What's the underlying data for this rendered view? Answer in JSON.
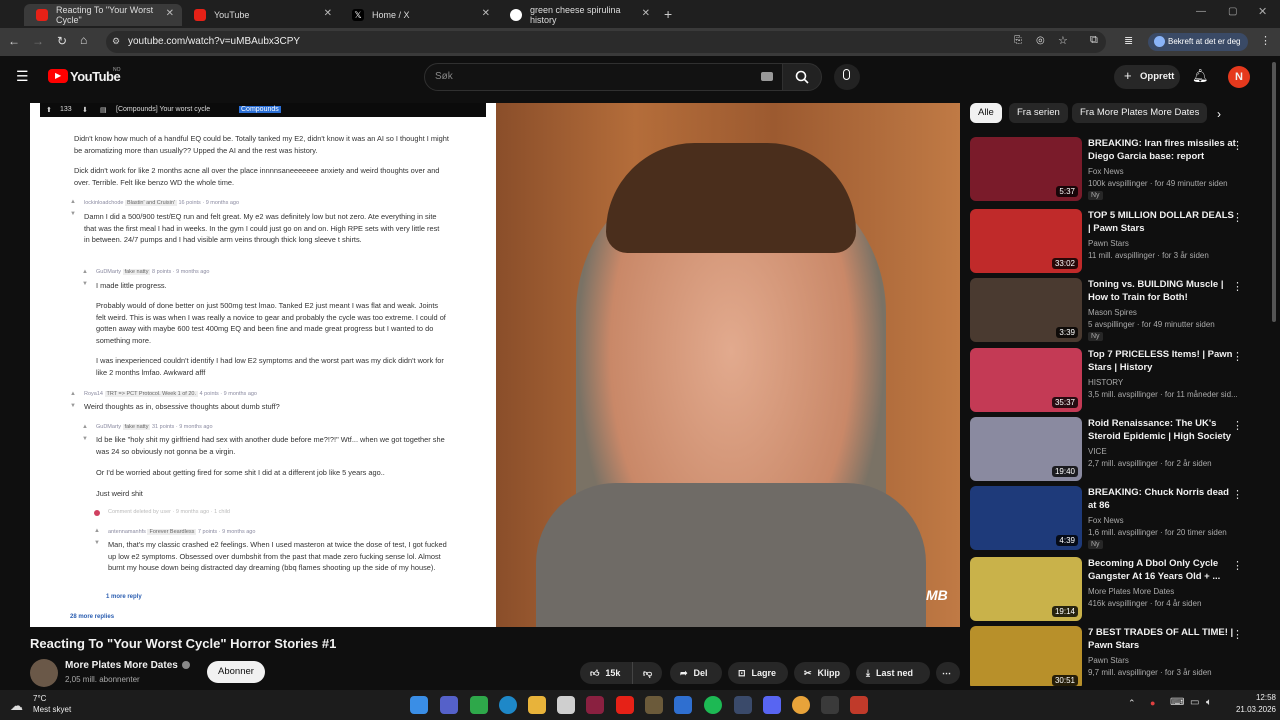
{
  "browser": {
    "tabs": [
      {
        "title": "Reacting To \"Your Worst Cycle\"",
        "active": true
      },
      {
        "title": "YouTube",
        "active": false
      },
      {
        "title": "Home / X",
        "active": false
      },
      {
        "title": "green cheese spirulina history",
        "active": false
      }
    ],
    "url": "youtube.com/watch?v=uMBAubx3CPY",
    "profile_label": "Bekreft at det er deg"
  },
  "youtube": {
    "logo": "YouTube",
    "logo_region": "NO",
    "search_placeholder": "Søk",
    "create_label": "Opprett",
    "avatar_letter": "N"
  },
  "reddit": {
    "vote_count": "133",
    "thread_title": "[Compounds] Your worst cycle",
    "flair": "Compounds",
    "paragraphs": [
      "Didn't know how much of a handful EQ could be. Totally tanked my E2, didn't know it was an AI so I thought I might be aromatizing more than usually?? Upped the AI and the rest was history.",
      "Dick didn't work for like 2 months acne all over the place innnnsaneeeeeee anxiety and weird thoughts over and over. Terrible. Felt like benzo WD the whole time."
    ],
    "comments": [
      {
        "user": "lockinloadchode",
        "flair": "Blastin' and Cruisin'",
        "meta": "16 points · 9 months ago",
        "text": "Damn I did a 500/900 test/EQ run and felt great. My e2 was definitely low but not zero. Ate everything in site that was the first meal I had in weeks. In the gym I could just go on and on. High RPE sets with very little rest in between. 24/7 pumps and I had visible arm veins through thick long sleeve t shirts."
      },
      {
        "user": "GuDMarty",
        "flair": "fake natty",
        "meta": "8 points · 9 months ago",
        "text": "I made little progress."
      },
      {
        "user": "",
        "flair": "",
        "meta": "",
        "text": "Probably would of done better on just 500mg test lmao. Tanked E2 just meant I was flat and weak. Joints felt weird. This is was when I was really a novice to gear and probably the cycle was too extreme. I could of gotten away with maybe 600 test 400mg EQ and been fine and made great progress but I wanted to do something more."
      },
      {
        "user": "",
        "flair": "",
        "meta": "",
        "text": "I was inexperienced couldn't identify I had low E2 symptoms and the worst part was my dick didn't work for like 2 months lmfao. Awkward afff"
      },
      {
        "user": "Roya14",
        "flair": "TRT => PCT Protocol. Week 1 of 20.",
        "meta": "4 points · 9 months ago",
        "text": "Weird thoughts as in, obsessive thoughts about dumb stuff?"
      },
      {
        "user": "GuDMarty",
        "flair": "fake natty",
        "meta": "31 points · 9 months ago",
        "text": "Id be like \"holy shit my girlfriend had sex with another dude before me?!?!\" Wtf... when we got together she was 24 so obviously not gonna be a virgin."
      },
      {
        "user": "",
        "flair": "",
        "meta": "",
        "text": "Or I'd be worried about getting fired for some shit I did at a different job like 5 years ago.."
      },
      {
        "user": "",
        "flair": "",
        "meta": "",
        "text": "Just weird shit"
      },
      {
        "user": "",
        "flair": "",
        "meta": "",
        "text": "Comment deleted by user · 9 months ago · 1 child"
      },
      {
        "user": "antennamanhfs",
        "flair": "Forever Beardless",
        "meta": "7 points · 9 months ago",
        "text": "Man, that's my classic crashed e2 feelings. When I used masteron at twice the dose of test, I got fucked up low e2 symptoms. Obsessed over dumbshit from the past that made zero fucking sense lol. Almost burnt my house down being distracted day dreaming (bbq flames shooting up the side of my house)."
      }
    ],
    "reply_link": "1 more reply",
    "more_replies": "28 more replies"
  },
  "filters": [
    "Alle",
    "Fra serien",
    "Fra More Plates More Dates"
  ],
  "recommendations": [
    {
      "title": "BREAKING: Iran fires missiles at Diego Garcia base: report",
      "channel": "Fox News",
      "meta": "100k avspillinger · for 49 minutter siden",
      "badge": "Ny",
      "duration": "5:37",
      "color": "#7a1b2a"
    },
    {
      "title": "TOP 5 MILLION DOLLAR DEALS | Pawn Stars",
      "channel": "Pawn Stars",
      "meta": "11 mill. avspillinger · for 3 år siden",
      "badge": "",
      "duration": "33:02",
      "color": "#c02a2a"
    },
    {
      "title": "Toning vs. BUILDING Muscle | How to Train for Both!",
      "channel": "Mason Spires",
      "meta": "5 avspillinger · for 49 minutter siden",
      "badge": "Ny",
      "duration": "3:39",
      "color": "#4a3a30"
    },
    {
      "title": "Top 7 PRICELESS Items! | Pawn Stars | History",
      "channel": "HISTORY",
      "meta": "3,5 mill. avspillinger · for 11 måneder sid...",
      "badge": "",
      "duration": "35:37",
      "color": "#c43a55"
    },
    {
      "title": "Roid Renaissance: The UK's Steroid Epidemic | High Society",
      "channel": "VICE",
      "meta": "2,7 mill. avspillinger · for 2 år siden",
      "badge": "",
      "duration": "19:40",
      "color": "#8a8aa0"
    },
    {
      "title": "BREAKING: Chuck Norris dead at 86",
      "channel": "Fox News",
      "meta": "1,6 mill. avspillinger · for 20 timer siden",
      "badge": "Ny",
      "duration": "4:39",
      "color": "#1e3a7a"
    },
    {
      "title": "Becoming A Dbol Only Cycle Gangster At 16 Years Old + ...",
      "channel": "More Plates More Dates",
      "meta": "416k avspillinger · for 4 år siden",
      "badge": "",
      "duration": "19:14",
      "color": "#c9b24a"
    },
    {
      "title": "7 BEST TRADES OF ALL TIME! | Pawn Stars",
      "channel": "Pawn Stars",
      "meta": "9,7 mill. avspillinger · for 3 år siden",
      "badge": "",
      "duration": "30:51",
      "color": "#b8902a"
    }
  ],
  "video": {
    "title": "Reacting To \"Your Worst Cycle\" Horror Stories #1",
    "channel": "More Plates More Dates",
    "subscribers": "2,05 mill. abonnenter",
    "subscribe_label": "Abonner",
    "likes": "15k",
    "share_label": "Del",
    "save_label": "Lagre",
    "clip_label": "Klipp",
    "download_label": "Last ned",
    "watermark": "MB"
  },
  "taskbar": {
    "temperature": "7°C",
    "weather": "Mest skyet",
    "time": "12:58",
    "date": "21.03.2026"
  }
}
